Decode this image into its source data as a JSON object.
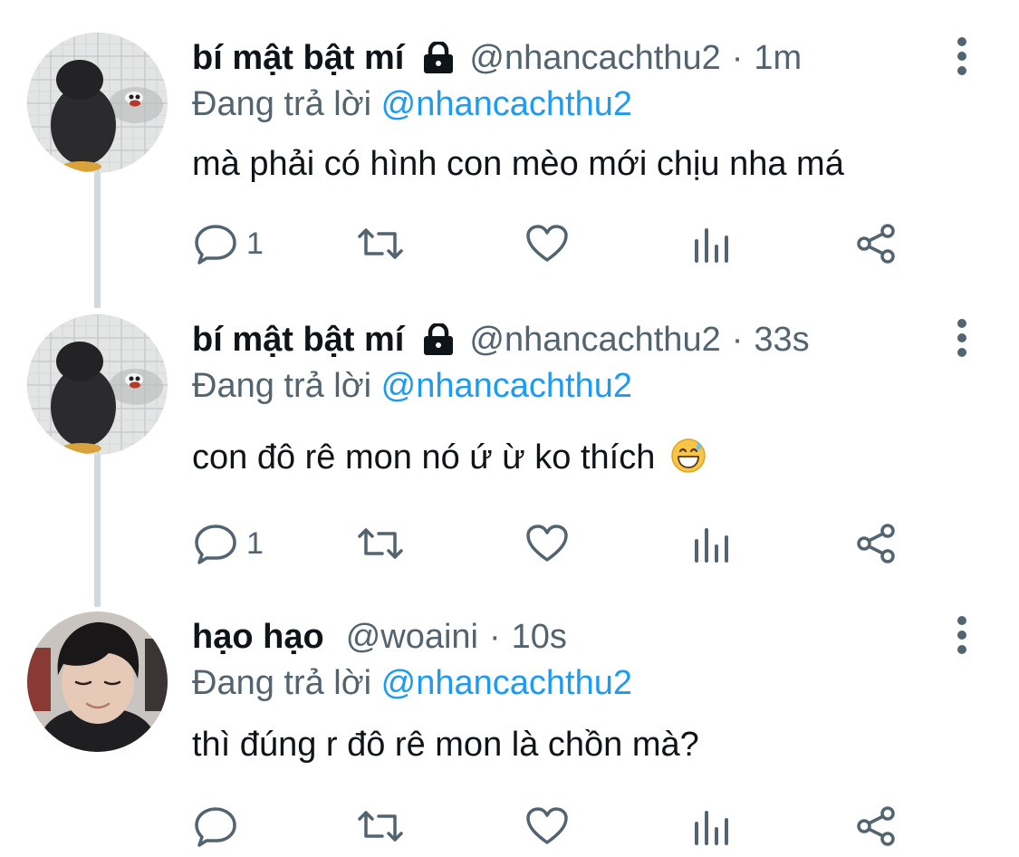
{
  "tweets": [
    {
      "display_name": "bí mật bật mí",
      "handle": "@nhancachthu2",
      "separator": "·",
      "time": "1m",
      "protected": true,
      "replying_prefix": "Đang trả lời",
      "replying_to": "@nhancachthu2",
      "text": "mà phải có hình con mèo mới chịu nha má",
      "reply_count": "1",
      "avatar": "penguin-plush-avatar"
    },
    {
      "display_name": "bí mật bật mí",
      "handle": "@nhancachthu2",
      "separator": "·",
      "time": "33s",
      "protected": true,
      "replying_prefix": "Đang trả lời",
      "replying_to": "@nhancachthu2",
      "text": "con đô rê mon nó ứ ừ ko thích",
      "emoji": "grinning-face-with-sweat-emoji",
      "reply_count": "1",
      "avatar": "penguin-plush-avatar"
    },
    {
      "display_name": "hạo hạo",
      "handle": "@woaini",
      "separator": "·",
      "time": "10s",
      "protected": false,
      "replying_prefix": "Đang trả lời",
      "replying_to": "@nhancachthu2",
      "text": "thì đúng r đô rê mon là chồn mà?",
      "reply_count": "",
      "avatar": "person-selfie-avatar"
    }
  ],
  "icons": {
    "reply": "reply-icon",
    "retweet": "retweet-icon",
    "like": "like-icon",
    "views": "views-icon",
    "share": "share-icon",
    "more": "more-options-icon",
    "lock": "lock-icon"
  },
  "colors": {
    "text": "#0f1419",
    "secondary": "#536471",
    "accent": "#1d9bf0",
    "thread_line": "#cfd9de"
  }
}
